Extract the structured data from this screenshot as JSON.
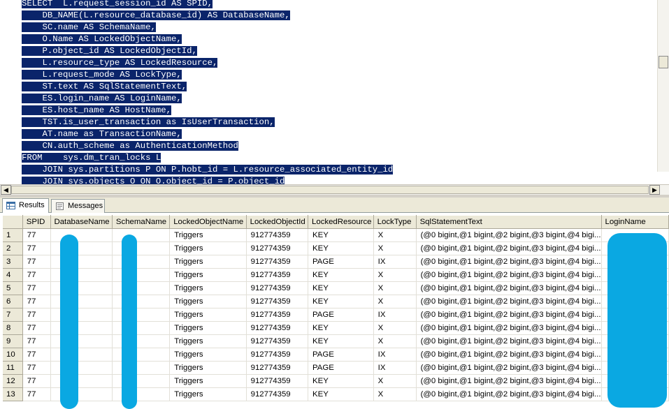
{
  "editor": {
    "lines": [
      {
        "text": "SELECT  L.request_session_id AS SPID,",
        "selected": true
      },
      {
        "text": "    DB_NAME(L.resource_database_id) AS DatabaseName,",
        "selected": true
      },
      {
        "text": "    SC.name AS SchemaName,",
        "selected": true
      },
      {
        "text": "    O.Name AS LockedObjectName,",
        "selected": true
      },
      {
        "text": "    P.object_id AS LockedObjectId,",
        "selected": true
      },
      {
        "text": "    L.resource_type AS LockedResource,",
        "selected": true
      },
      {
        "text": "    L.request_mode AS LockType,",
        "selected": true
      },
      {
        "text": "    ST.text AS SqlStatementText,",
        "selected": true
      },
      {
        "text": "    ES.login_name AS LoginName,",
        "selected": true
      },
      {
        "text": "    ES.host_name AS HostName,",
        "selected": true
      },
      {
        "text": "    TST.is_user_transaction as IsUserTransaction,",
        "selected": true
      },
      {
        "text": "    AT.name as TransactionName,",
        "selected": true
      },
      {
        "text": "    CN.auth_scheme as AuthenticationMethod",
        "selected": true
      },
      {
        "text": "FROM    sys.dm_tran_locks L",
        "selected": true
      },
      {
        "text": "    JOIN sys.partitions P ON P.hobt_id = L.resource_associated_entity_id",
        "selected": true
      },
      {
        "text": "    JOIN sys.objects O ON O.object_id = P.object_id",
        "selected": true
      }
    ]
  },
  "tabs": [
    {
      "label": "Results",
      "active": true,
      "icon": "grid-icon"
    },
    {
      "label": "Messages",
      "active": false,
      "icon": "messages-icon"
    }
  ],
  "grid": {
    "columns": [
      "SPID",
      "DatabaseName",
      "SchemaName",
      "LockedObjectName",
      "LockedObjectId",
      "LockedResource",
      "LockType",
      "SqlStatementText",
      "LoginName"
    ],
    "rows": [
      {
        "n": "1",
        "spid": "77",
        "db": "",
        "schema": "",
        "obj": "Triggers",
        "objid": "912774359",
        "res": "KEY",
        "lock": "X",
        "sql": "(@0 bigint,@1 bigint,@2 bigint,@3 bigint,@4 bigi...",
        "login": ""
      },
      {
        "n": "2",
        "spid": "77",
        "db": "",
        "schema": "",
        "obj": "Triggers",
        "objid": "912774359",
        "res": "KEY",
        "lock": "X",
        "sql": "(@0 bigint,@1 bigint,@2 bigint,@3 bigint,@4 bigi...",
        "login": ""
      },
      {
        "n": "3",
        "spid": "77",
        "db": "",
        "schema": "",
        "obj": "Triggers",
        "objid": "912774359",
        "res": "PAGE",
        "lock": "IX",
        "sql": "(@0 bigint,@1 bigint,@2 bigint,@3 bigint,@4 bigi...",
        "login": ""
      },
      {
        "n": "4",
        "spid": "77",
        "db": "",
        "schema": "",
        "obj": "Triggers",
        "objid": "912774359",
        "res": "KEY",
        "lock": "X",
        "sql": "(@0 bigint,@1 bigint,@2 bigint,@3 bigint,@4 bigi...",
        "login": ""
      },
      {
        "n": "5",
        "spid": "77",
        "db": "",
        "schema": "",
        "obj": "Triggers",
        "objid": "912774359",
        "res": "KEY",
        "lock": "X",
        "sql": "(@0 bigint,@1 bigint,@2 bigint,@3 bigint,@4 bigi...",
        "login": ""
      },
      {
        "n": "6",
        "spid": "77",
        "db": "",
        "schema": "",
        "obj": "Triggers",
        "objid": "912774359",
        "res": "KEY",
        "lock": "X",
        "sql": "(@0 bigint,@1 bigint,@2 bigint,@3 bigint,@4 bigi...",
        "login": ""
      },
      {
        "n": "7",
        "spid": "77",
        "db": "",
        "schema": "",
        "obj": "Triggers",
        "objid": "912774359",
        "res": "PAGE",
        "lock": "IX",
        "sql": "(@0 bigint,@1 bigint,@2 bigint,@3 bigint,@4 bigi...",
        "login": ""
      },
      {
        "n": "8",
        "spid": "77",
        "db": "",
        "schema": "",
        "obj": "Triggers",
        "objid": "912774359",
        "res": "KEY",
        "lock": "X",
        "sql": "(@0 bigint,@1 bigint,@2 bigint,@3 bigint,@4 bigi...",
        "login": ""
      },
      {
        "n": "9",
        "spid": "77",
        "db": "",
        "schema": "",
        "obj": "Triggers",
        "objid": "912774359",
        "res": "KEY",
        "lock": "X",
        "sql": "(@0 bigint,@1 bigint,@2 bigint,@3 bigint,@4 bigi...",
        "login": ""
      },
      {
        "n": "10",
        "spid": "77",
        "db": "",
        "schema": "",
        "obj": "Triggers",
        "objid": "912774359",
        "res": "PAGE",
        "lock": "IX",
        "sql": "(@0 bigint,@1 bigint,@2 bigint,@3 bigint,@4 bigi...",
        "login": ""
      },
      {
        "n": "11",
        "spid": "77",
        "db": "",
        "schema": "",
        "obj": "Triggers",
        "objid": "912774359",
        "res": "PAGE",
        "lock": "IX",
        "sql": "(@0 bigint,@1 bigint,@2 bigint,@3 bigint,@4 bigi...",
        "login": ""
      },
      {
        "n": "12",
        "spid": "77",
        "db": "",
        "schema": "",
        "obj": "Triggers",
        "objid": "912774359",
        "res": "KEY",
        "lock": "X",
        "sql": "(@0 bigint,@1 bigint,@2 bigint,@3 bigint,@4 bigi...",
        "login": ""
      },
      {
        "n": "13",
        "spid": "77",
        "db": "",
        "schema": "",
        "obj": "Triggers",
        "objid": "912774359",
        "res": "KEY",
        "lock": "X",
        "sql": "(@0 bigint,@1 bigint,@2 bigint,@3 bigint,@4 bigi...",
        "login": ""
      }
    ]
  },
  "colors": {
    "selection": "#0a246a",
    "redaction": "#0aa8e2",
    "chrome": "#ece9d8"
  }
}
